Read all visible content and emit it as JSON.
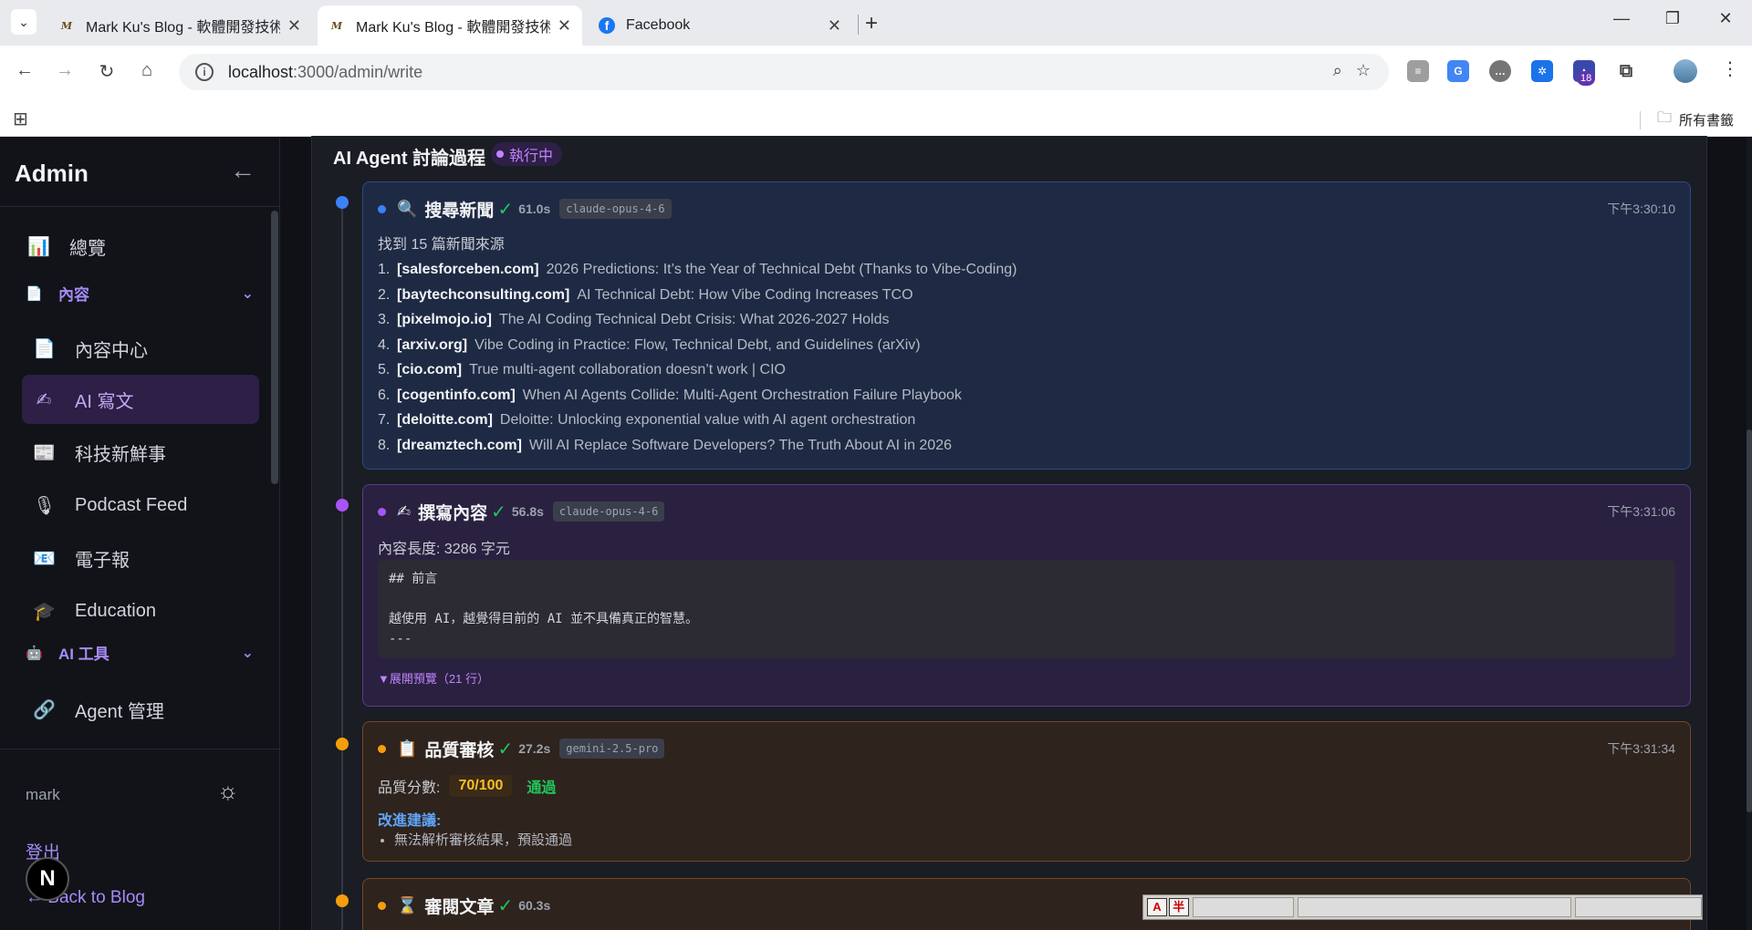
{
  "browser": {
    "tabs": [
      {
        "title": "Mark Ku's Blog - 軟體開發技術",
        "active": false
      },
      {
        "title": "Mark Ku's Blog - 軟體開發技術",
        "active": true
      },
      {
        "title": "Facebook",
        "active": false
      }
    ],
    "url_host": "localhost",
    "url_path": ":3000/admin/write",
    "bookmarks_label": "所有書籤",
    "ext_badge": "18"
  },
  "sidebar": {
    "brand": "Admin",
    "items": {
      "overview": "總覽",
      "content_group": "內容",
      "content_center": "內容中心",
      "ai_writing": "AI 寫文",
      "tech_news": "科技新鮮事",
      "podcast": "Podcast Feed",
      "newsletter": "電子報",
      "education": "Education",
      "ai_tools_group": "AI 工具",
      "agent_mgmt": "Agent 管理"
    },
    "user": "mark",
    "logout": "登出",
    "back": "← Back to Blog",
    "badge_letter": "N"
  },
  "main": {
    "title": "AI Agent 討論過程",
    "status": "執行中",
    "steps": {
      "search": {
        "name": "搜尋新聞",
        "duration": "61.0s",
        "model": "claude-opus-4-6",
        "time": "下午3:30:10",
        "summary": "找到 15 篇新聞來源",
        "sources": [
          {
            "num": "1.",
            "domain": "[salesforceben.com]",
            "title": "2026 Predictions: It’s the Year of Technical Debt (Thanks to Vibe-Coding)"
          },
          {
            "num": "2.",
            "domain": "[baytechconsulting.com]",
            "title": "AI Technical Debt: How Vibe Coding Increases TCO"
          },
          {
            "num": "3.",
            "domain": "[pixelmojo.io]",
            "title": "The AI Coding Technical Debt Crisis: What 2026-2027 Holds"
          },
          {
            "num": "4.",
            "domain": "[arxiv.org]",
            "title": "Vibe Coding in Practice: Flow, Technical Debt, and Guidelines (arXiv)"
          },
          {
            "num": "5.",
            "domain": "[cio.com]",
            "title": "True multi-agent collaboration doesn’t work | CIO"
          },
          {
            "num": "6.",
            "domain": "[cogentinfo.com]",
            "title": "When AI Agents Collide: Multi-Agent Orchestration Failure Playbook"
          },
          {
            "num": "7.",
            "domain": "[deloitte.com]",
            "title": "Deloitte: Unlocking exponential value with AI agent orchestration"
          },
          {
            "num": "8.",
            "domain": "[dreamztech.com]",
            "title": "Will AI Replace Software Developers? The Truth About AI in 2026"
          }
        ]
      },
      "write": {
        "name": "撰寫內容",
        "duration": "56.8s",
        "model": "claude-opus-4-6",
        "time": "下午3:31:06",
        "length_label": "內容長度: 3286 字元",
        "preview": "## 前言\n\n越使用 AI，越覺得目前的 AI 並不具備真正的智慧。\n---",
        "expand": "▼展開預覽（21 行）"
      },
      "review": {
        "name": "品質審核",
        "duration": "27.2s",
        "model": "gemini-2.5-pro",
        "time": "下午3:31:34",
        "score_label": "品質分數:",
        "score": "70/100",
        "result": "通過",
        "suggest_title": "改進建議:",
        "suggestions": [
          "無法解析審核結果，預設通過"
        ]
      },
      "proofread": {
        "name": "審閱文章",
        "duration": "60.3s"
      }
    }
  },
  "ime": {
    "mode": "A",
    "width": "半"
  }
}
